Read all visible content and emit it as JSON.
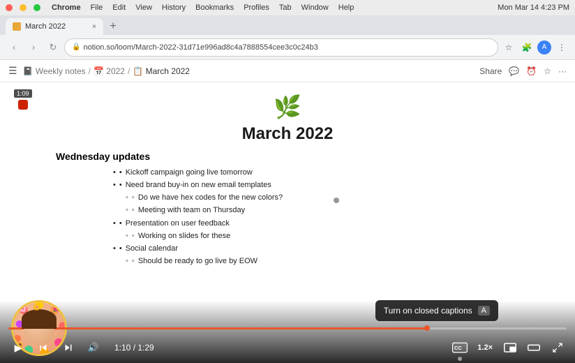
{
  "mac": {
    "time": "Mon Mar 14  4:23 PM",
    "menu_items": [
      "Chrome",
      "File",
      "Edit",
      "View",
      "History",
      "Bookmarks",
      "Profiles",
      "Tab",
      "Window",
      "Help"
    ]
  },
  "browser": {
    "tab_title": "March 2022",
    "tab_close": "×",
    "url": "notion.so/loom/March-2022-31d71e996ad8c4a7888554cee3c0c24b3",
    "nav": {
      "back": "‹",
      "forward": "›",
      "refresh": "↻"
    }
  },
  "notion": {
    "breadcrumbs": [
      "Weekly notes",
      "2022",
      "March 2022"
    ],
    "right_actions": [
      "Share",
      "💬",
      "⏰",
      "☆",
      "···"
    ],
    "page": {
      "icon": "🌿",
      "title": "March 2022",
      "section": "Wednesday updates",
      "bullets": [
        {
          "text": "Kickoff campaign going live tomorrow",
          "level": 0
        },
        {
          "text": "Need brand buy-in on new email templates",
          "level": 0
        },
        {
          "text": "Do we have hex codes for the new colors?",
          "level": 1
        },
        {
          "text": "Meeting with team on Thursday",
          "level": 1
        },
        {
          "text": "Presentation on user feedback",
          "level": 0
        },
        {
          "text": "Working on slides for these",
          "level": 1
        },
        {
          "text": "Social calendar",
          "level": 0
        },
        {
          "text": "Should be ready to go live by EOW",
          "level": 1
        }
      ]
    }
  },
  "video": {
    "record_time": "1:09",
    "cc_tooltip": "Turn on closed captions",
    "cc_shortcut": "A",
    "current_time": "1:10",
    "total_time": "1:29",
    "progress_percent": 75,
    "speed": "1.2×",
    "controls": {
      "play": "▶",
      "rewind": "↺",
      "forward": "↻",
      "volume": "🔊"
    }
  }
}
